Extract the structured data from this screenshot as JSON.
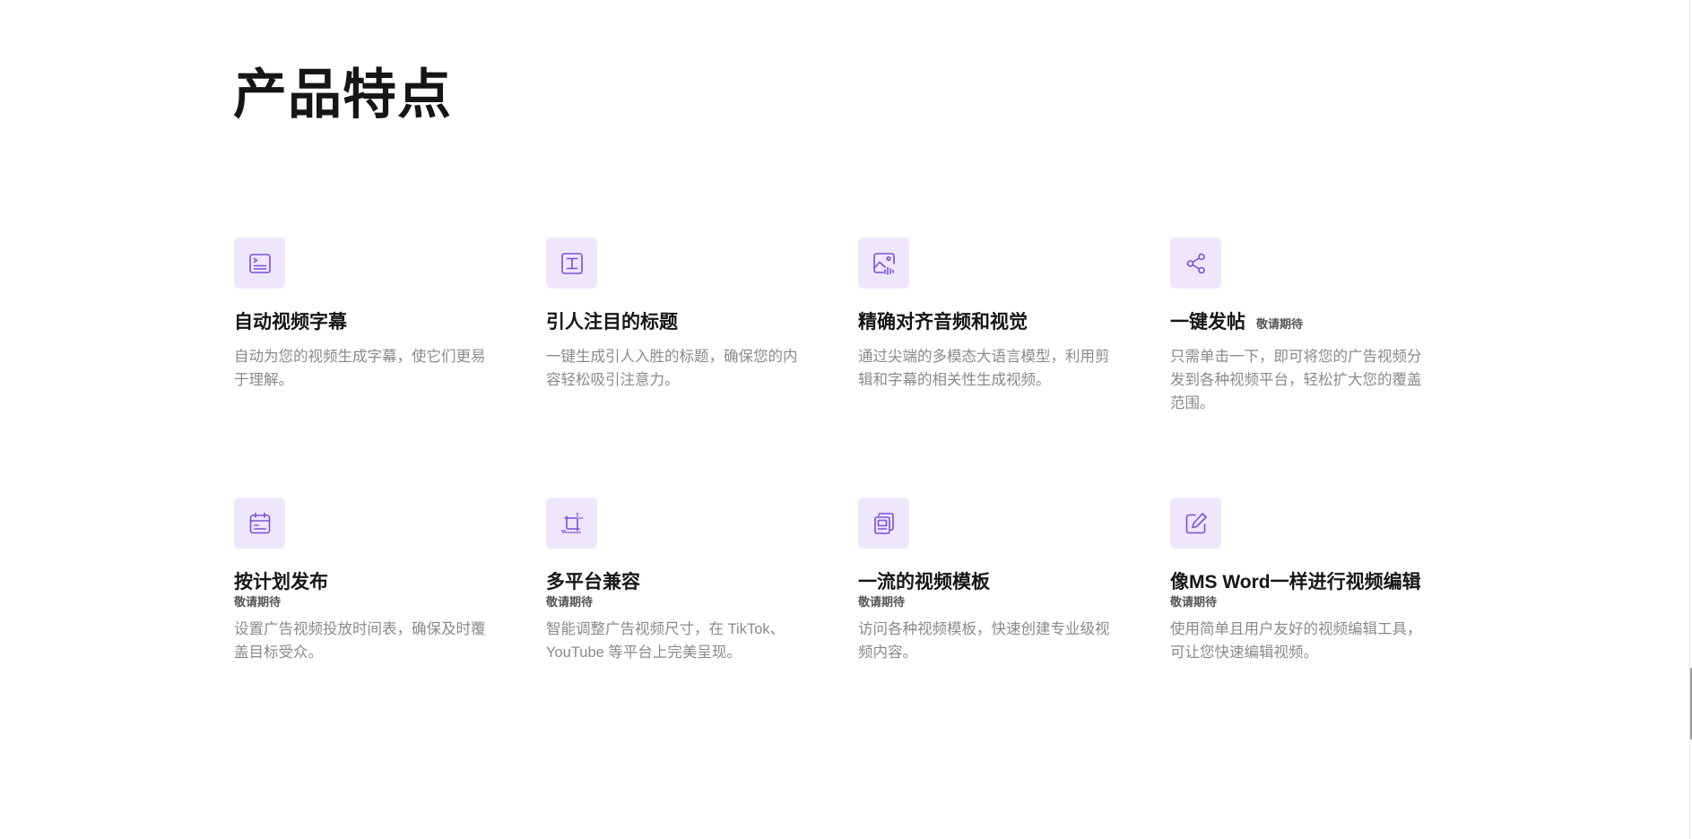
{
  "section": {
    "title": "产品特点"
  },
  "features": [
    {
      "icon": "subtitles-icon",
      "title": "自动视频字幕",
      "badge": "",
      "desc": "自动为您的视频生成字幕，使它们更易于理解。"
    },
    {
      "icon": "text-title-icon",
      "title": "引人注目的标题",
      "badge": "",
      "desc": "一键生成引人入胜的标题，确保您的内容轻松吸引注意力。"
    },
    {
      "icon": "image-audio-icon",
      "title": "精确对齐音频和视觉",
      "badge": "",
      "desc": "通过尖端的多模态大语言模型，利用剪辑和字幕的相关性生成视频。"
    },
    {
      "icon": "share-icon",
      "title": "一键发帖",
      "badge": "敬请期待",
      "desc": "只需单击一下，即可将您的广告视频分发到各种视频平台，轻松扩大您的覆盖范围。"
    },
    {
      "icon": "calendar-icon",
      "title": "按计划发布",
      "badge": "敬请期待",
      "desc": "设置广告视频投放时间表，确保及时覆盖目标受众。"
    },
    {
      "icon": "crop-icon",
      "title": "多平台兼容",
      "badge": "敬请期待",
      "desc": "智能调整广告视频尺寸，在 TikTok、YouTube 等平台上完美呈现。"
    },
    {
      "icon": "template-stack-icon",
      "title": "一流的视频模板",
      "badge": "敬请期待",
      "desc": "访问各种视频模板，快速创建专业级视频内容。"
    },
    {
      "icon": "edit-icon",
      "title": "像MS Word一样进行视频编辑",
      "badge": "敬请期待",
      "desc": "使用简单且用户友好的视频编辑工具，可让您快速编辑视频。"
    }
  ],
  "colors": {
    "accent": "#7b4fd6",
    "icon_bg": "#ede6fd",
    "desc_text": "#8a8a8a"
  }
}
